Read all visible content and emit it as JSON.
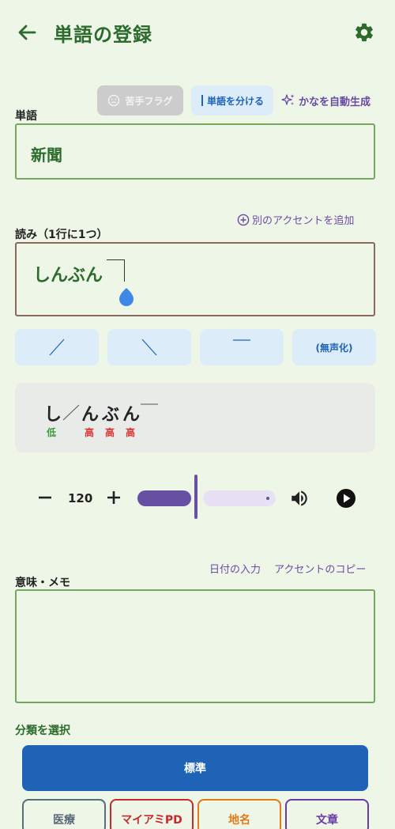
{
  "header": {
    "title": "単語の登録"
  },
  "toolbar": {
    "weak_flag": "苦手フラグ",
    "split_word": "単語を分ける",
    "auto_kana": "かなを自動生成"
  },
  "word": {
    "label": "単語",
    "value": "新聞"
  },
  "reading": {
    "label": "読み（1行に1つ）",
    "add_accent": "別のアクセントを追加",
    "value": "しんぶん"
  },
  "accent_buttons": {
    "devoice": "(無声化)"
  },
  "preview": {
    "chars": [
      "し",
      "ん",
      "ぶ",
      "ん"
    ],
    "pitch": [
      "低",
      "高",
      "高",
      "高"
    ]
  },
  "playback": {
    "speed": "120",
    "slider_fraction": 0.42
  },
  "memo": {
    "label": "意味・メモ",
    "date_link": "日付の入力",
    "copy_accent_link": "アクセントのコピー",
    "value": ""
  },
  "category": {
    "label": "分類を選択",
    "selected": "標準",
    "options": [
      "医療",
      "マイアミPD",
      "地名",
      "文章"
    ]
  },
  "colors": {
    "background": "#eef6e8",
    "primary_green": "#2c6b2c",
    "accent_blue": "#1e63b6",
    "purple": "#6a4ba4",
    "low_pitch": "#3d9a3d",
    "high_pitch": "#d83030"
  },
  "icons": {
    "back": "arrow-left-icon",
    "settings": "gear-icon",
    "weak_flag": "sad-face-icon",
    "auto_kana": "sparkle-icon",
    "add_accent": "plus-circle-icon",
    "minus": "minus-icon",
    "plus": "plus-icon",
    "volume": "volume-icon",
    "play": "play-icon"
  }
}
